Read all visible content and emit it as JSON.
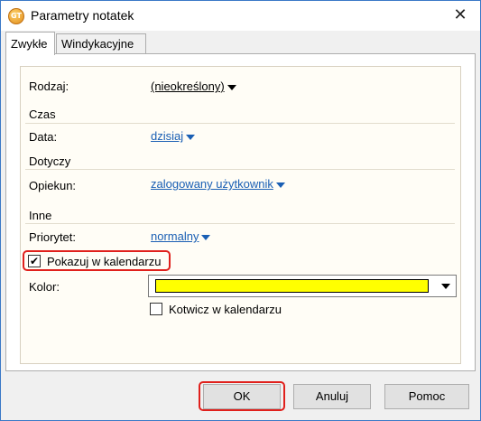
{
  "window": {
    "title": "Parametry notatek",
    "app_icon_text": "GT",
    "close_symbol": "✕"
  },
  "tabs": [
    {
      "label": "Zwykłe",
      "active": true
    },
    {
      "label": "Windykacyjne",
      "active": false
    }
  ],
  "fields": {
    "rodzaj": {
      "label": "Rodzaj:",
      "value": "(nieokreślony)"
    },
    "czas_section": "Czas",
    "data": {
      "label": "Data:",
      "value": "dzisiaj"
    },
    "dotyczy_section": "Dotyczy",
    "opiekun": {
      "label": "Opiekun:",
      "value": "zalogowany użytkownik"
    },
    "inne_section": "Inne",
    "priorytet": {
      "label": "Priorytet:",
      "value": "normalny"
    },
    "show_in_calendar": {
      "label": "Pokazuj w kalendarzu",
      "checked": true,
      "check_symbol": "✔"
    },
    "kolor": {
      "label": "Kolor:",
      "value_color": "#FFFF00"
    },
    "anchor_in_calendar": {
      "label": "Kotwicz w kalendarzu",
      "checked": false
    }
  },
  "buttons": {
    "ok": "OK",
    "cancel": "Anuluj",
    "help": "Pomoc"
  },
  "colors": {
    "link": "#1A5FB4",
    "highlight": "#E0201C",
    "title_border": "#3A79C7"
  }
}
